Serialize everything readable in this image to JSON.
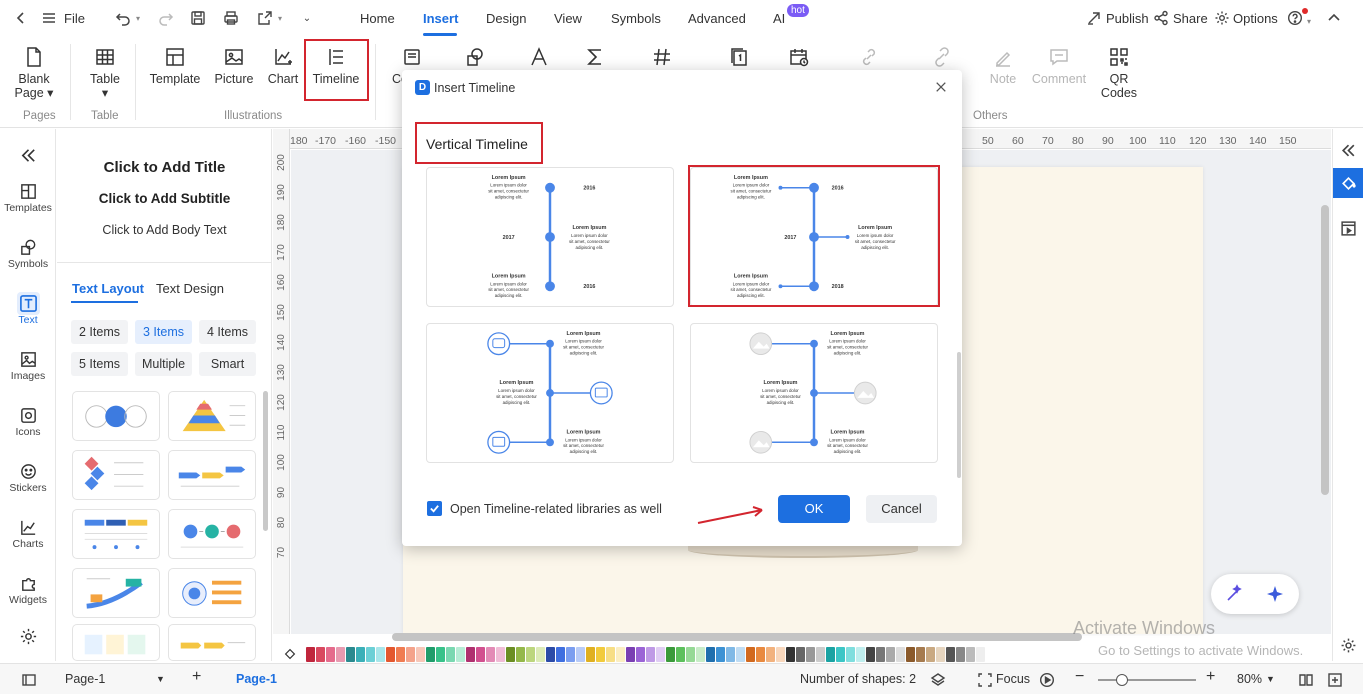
{
  "menubar": {
    "file_label": "File",
    "tabs": [
      {
        "label": "Home"
      },
      {
        "label": "Insert"
      },
      {
        "label": "Design"
      },
      {
        "label": "View"
      },
      {
        "label": "Symbols"
      },
      {
        "label": "Advanced"
      },
      {
        "label": "AI"
      }
    ],
    "ai_badge": "hot",
    "publish_label": "Publish",
    "share_label": "Share",
    "options_label": "Options"
  },
  "ribbon": {
    "buttons": {
      "blank_page": "Blank\nPage ▾",
      "table": "Table\n▾",
      "template": "Template",
      "picture": "Picture",
      "chart": "Chart",
      "timeline": "Timeline",
      "container": "Co",
      "note_partial": "nt",
      "note": "Note",
      "comment": "Comment",
      "qr_codes": "QR\nCodes"
    },
    "groups": {
      "pages": "Pages",
      "table": "Table",
      "illustrations": "Illustrations",
      "others": "Others"
    }
  },
  "rail": [
    {
      "label": "Templates",
      "icon": "templates-icon"
    },
    {
      "label": "Symbols",
      "icon": "symbols-icon"
    },
    {
      "label": "Text",
      "icon": "text-icon"
    },
    {
      "label": "Images",
      "icon": "images-icon"
    },
    {
      "label": "Icons",
      "icon": "icons-icon"
    },
    {
      "label": "Stickers",
      "icon": "stickers-icon"
    },
    {
      "label": "Charts",
      "icon": "charts-icon"
    },
    {
      "label": "Widgets",
      "icon": "widgets-icon"
    }
  ],
  "panel": {
    "title": "Click to Add Title",
    "subtitle": "Click to Add Subtitle",
    "body": "Click to Add Body Text",
    "tabs": [
      "Text Layout",
      "Text Design"
    ],
    "chips": [
      "2 Items",
      "3 Items",
      "4 Items",
      "5 Items",
      "Multiple",
      "Smart"
    ]
  },
  "rulers": {
    "h_ticks": [
      "180",
      "-170",
      "-160",
      "-150",
      "50",
      "60",
      "70",
      "80",
      "90",
      "100",
      "110",
      "120",
      "130",
      "140",
      "150"
    ],
    "v_ticks": [
      "200",
      "190",
      "180",
      "170",
      "160",
      "150",
      "140",
      "130",
      "120",
      "110",
      "100",
      "90",
      "80",
      "70"
    ]
  },
  "dialog": {
    "title": "Insert Timeline",
    "section": "Vertical Timeline",
    "checkbox_label": "Open Timeline-related libraries as well",
    "ok_label": "OK",
    "cancel_label": "Cancel",
    "card_text": {
      "heading": "Lorem Ipsum",
      "line1": "Lorem ipsum dolor",
      "line2": "sit amet, consectetur",
      "line3": "adipiscing elit.",
      "year_2016": "2016",
      "year_2017": "2017",
      "year_2018": "2018"
    }
  },
  "statusbar": {
    "page_select": "Page-1",
    "page_tab": "Page-1",
    "shapes": "Number of shapes: 2",
    "focus": "Focus",
    "zoom": "80%"
  },
  "watermark": {
    "line1": "Activate Windows",
    "line2": "Go to Settings to activate Windows."
  },
  "colors": {
    "accent": "#1d6fe0",
    "highlight": "#d3252e",
    "timeline_blue": "#4a86e8"
  }
}
